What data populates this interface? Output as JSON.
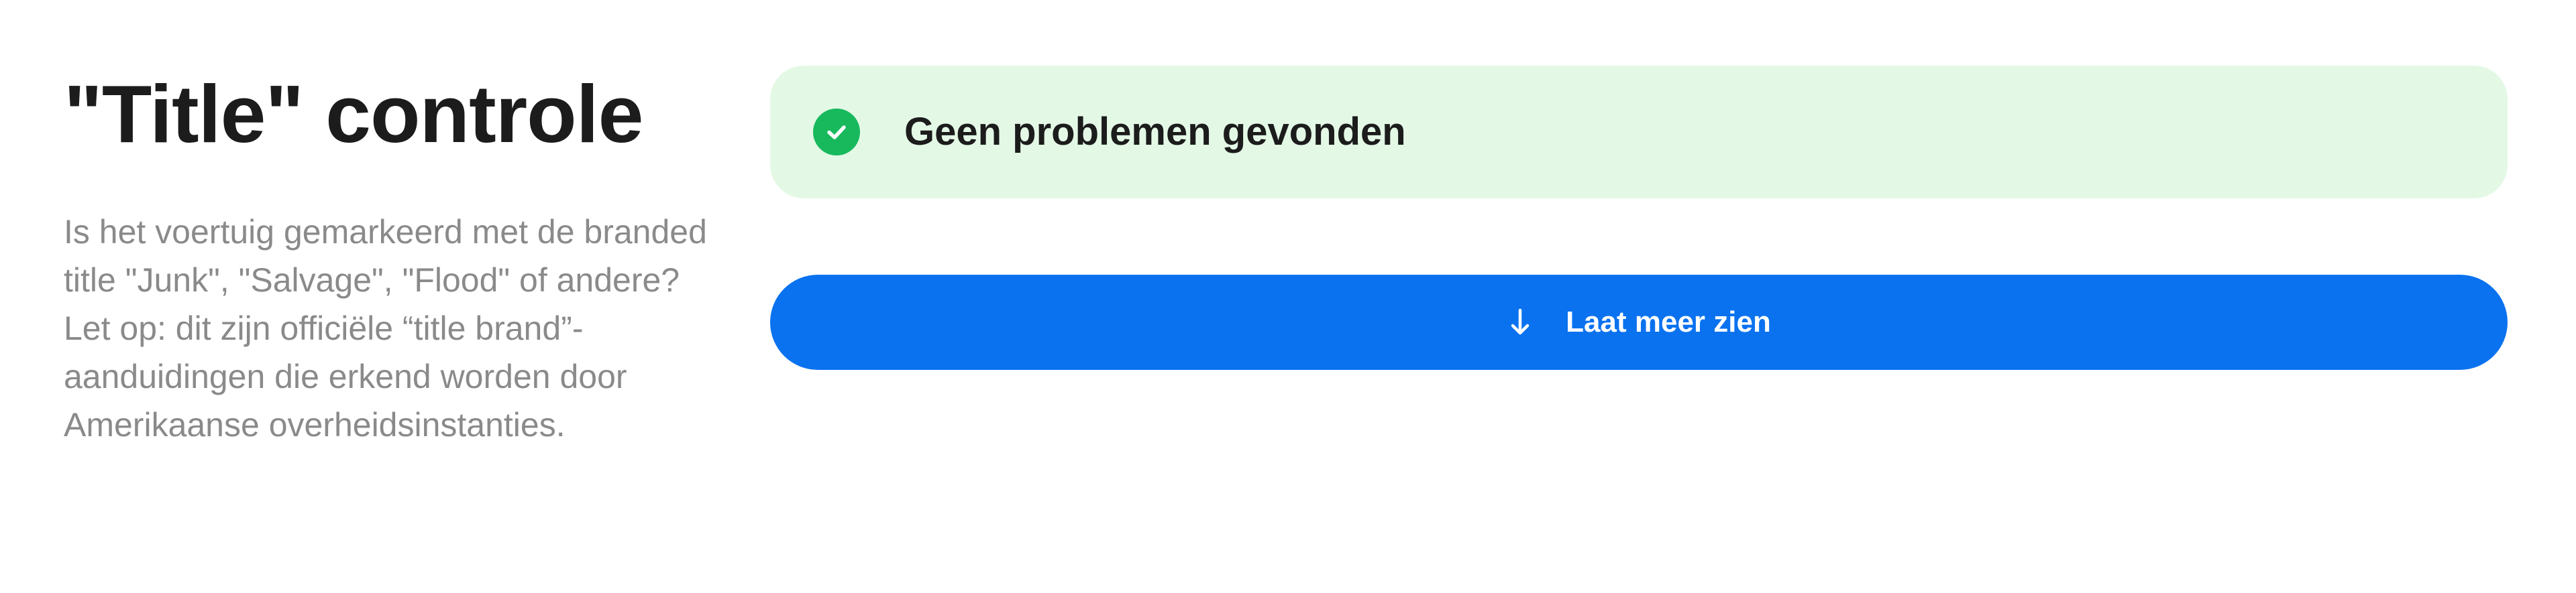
{
  "section": {
    "title": "\"Title\" controle",
    "description": "Is het voertuig gemarkeerd met de branded title \"Junk\", \"Salvage\", \"Flood\" of andere? Let op: dit zijn officiële “title brand”-aanduidingen die erkend worden door Amerikaanse overheidsinstanties."
  },
  "status": {
    "icon": "check-circle-icon",
    "text": "Geen problemen gevonden",
    "color": "#18b95c",
    "background": "#e3f9e6"
  },
  "actions": {
    "more_label": "Laat meer zien",
    "more_icon": "arrow-down-icon",
    "button_color": "#0a72ef"
  }
}
